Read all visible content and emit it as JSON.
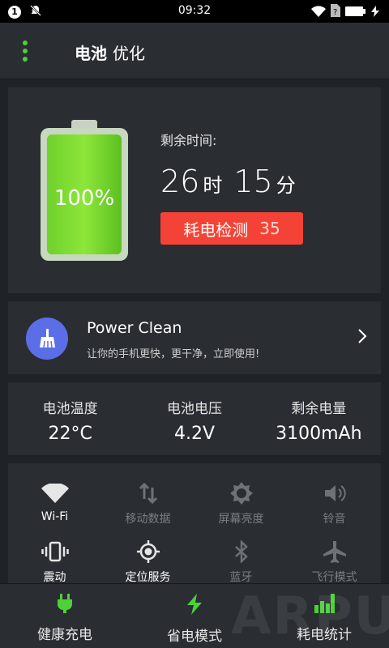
{
  "status_bar": {
    "notif_count": "1",
    "time": "09:32",
    "colors": {
      "bg": "#000000"
    }
  },
  "app_bar": {
    "title_main": "电池",
    "title_sub": "优化",
    "accent": "#4cd137"
  },
  "battery": {
    "percent_text": "100%",
    "level_fraction": 1.0,
    "remaining_label": "剩余时间:",
    "hours": "26",
    "hours_unit": "时",
    "minutes": "15",
    "minutes_unit": "分",
    "detect_label": "耗电检测",
    "detect_count": "35",
    "detect_color": "#f44336"
  },
  "power_clean": {
    "icon": "broom-icon",
    "title": "Power Clean",
    "subtitle": "让你的手机更快，更干净，立即使用!",
    "icon_color": "#5b6ee8"
  },
  "stats": [
    {
      "label": "电池温度",
      "value": "22°C"
    },
    {
      "label": "电池电压",
      "value": "4.2V"
    },
    {
      "label": "剩余电量",
      "value": "3100mAh"
    }
  ],
  "toggles": [
    {
      "label": "Wi-Fi",
      "icon": "wifi-icon",
      "on": true
    },
    {
      "label": "移动数据",
      "icon": "mobile-data-icon",
      "on": false
    },
    {
      "label": "屏幕亮度",
      "icon": "brightness-icon",
      "on": false
    },
    {
      "label": "铃音",
      "icon": "volume-icon",
      "on": false
    },
    {
      "label": "震动",
      "icon": "vibrate-icon",
      "on": true
    },
    {
      "label": "定位服务",
      "icon": "location-icon",
      "on": true
    },
    {
      "label": "蓝牙",
      "icon": "bluetooth-icon",
      "on": false
    },
    {
      "label": "飞行模式",
      "icon": "airplane-icon",
      "on": false
    }
  ],
  "bottom_nav": [
    {
      "label": "健康充电",
      "icon": "plug-icon"
    },
    {
      "label": "省电模式",
      "icon": "lightning-icon"
    },
    {
      "label": "耗电统计",
      "icon": "bar-chart-icon"
    }
  ],
  "watermark": "ARPUN"
}
